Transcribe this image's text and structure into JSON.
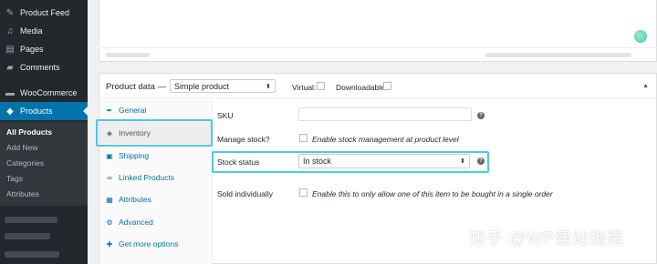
{
  "sidebar": {
    "top_items": [
      {
        "label": "Product Feed",
        "icon": "feed-icon"
      },
      {
        "label": "Media",
        "icon": "media-icon"
      },
      {
        "label": "Pages",
        "icon": "pages-icon"
      },
      {
        "label": "Comments",
        "icon": "comments-icon"
      }
    ],
    "woocommerce": {
      "label": "WooCommerce",
      "icon": "woocommerce-icon"
    },
    "products": {
      "label": "Products",
      "icon": "products-icon"
    },
    "submenu": [
      "All Products",
      "Add New",
      "Categories",
      "Tags",
      "Attributes"
    ]
  },
  "product_data": {
    "title": "Product data —",
    "type_select": "Simple product",
    "virtual_label": "Virtual:",
    "downloadable_label": "Downloadable:"
  },
  "tabs": [
    {
      "label": "General",
      "icon": "wrench-icon"
    },
    {
      "label": "Inventory",
      "icon": "tag-icon"
    },
    {
      "label": "Shipping",
      "icon": "truck-icon"
    },
    {
      "label": "Linked Products",
      "icon": "link-icon"
    },
    {
      "label": "Attributes",
      "icon": "table-icon"
    },
    {
      "label": "Advanced",
      "icon": "gear-icon"
    },
    {
      "label": "Get more options",
      "icon": "plugin-icon"
    }
  ],
  "inventory": {
    "sku_label": "SKU",
    "manage_stock_label": "Manage stock?",
    "manage_stock_desc": "Enable stock management at product level",
    "stock_status_label": "Stock status",
    "stock_status_value": "In stock",
    "sold_individually_label": "Sold individually",
    "sold_individually_desc": "Enable this to only allow one of this item to be bought in a single order"
  },
  "watermark": "知乎 @WP建站指南",
  "colors": {
    "sidebar_bg": "#23282d",
    "active_blue": "#0073aa",
    "highlight": "#4dc8e6"
  }
}
